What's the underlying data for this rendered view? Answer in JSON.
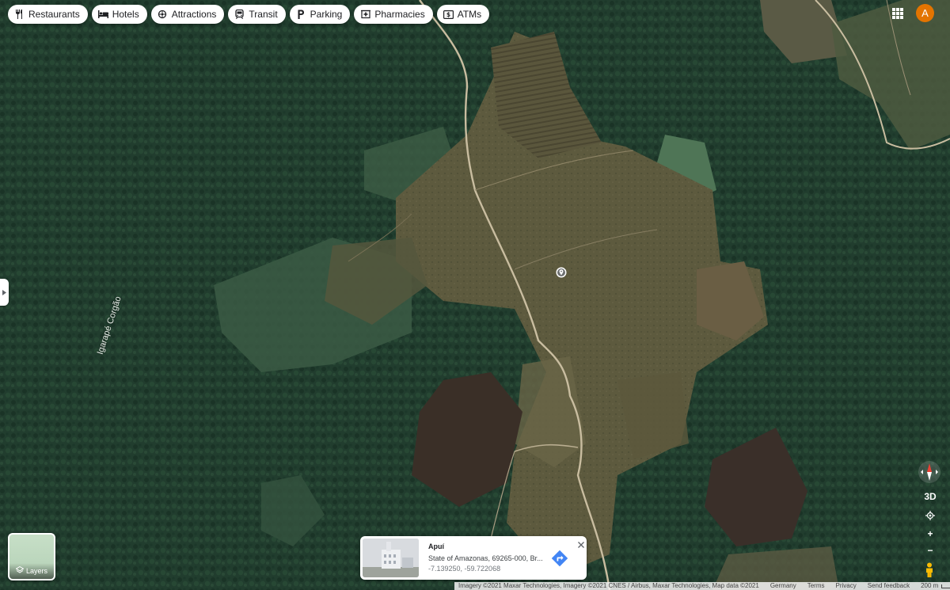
{
  "categories": [
    {
      "label": "Restaurants",
      "icon": "restaurant-icon"
    },
    {
      "label": "Hotels",
      "icon": "hotel-icon"
    },
    {
      "label": "Attractions",
      "icon": "attractions-icon"
    },
    {
      "label": "Transit",
      "icon": "transit-icon"
    },
    {
      "label": "Parking",
      "icon": "parking-icon"
    },
    {
      "label": "Pharmacies",
      "icon": "pharmacy-icon"
    },
    {
      "label": "ATMs",
      "icon": "atm-icon"
    }
  ],
  "account": {
    "initial": "A",
    "color": "#e37400"
  },
  "map": {
    "place_label": "Igarapé Corgão",
    "view": "satellite"
  },
  "layers": {
    "label": "Layers"
  },
  "info_card": {
    "title": "Apuí",
    "address": "State of Amazonas, 69265-000, Br...",
    "coordinates": "-7.139250, -59.722068"
  },
  "controls": {
    "tilt_label": "3D",
    "zoom_in": "+",
    "zoom_out": "−"
  },
  "footer": {
    "attribution": "Imagery ©2021 Maxar Technologies, Imagery ©2021 CNES / Airbus, Maxar Technologies, Map data ©2021",
    "region": "Germany",
    "terms": "Terms",
    "privacy": "Privacy",
    "feedback": "Send feedback",
    "scale": "200 m"
  },
  "colors": {
    "forest": "#1f3a2c",
    "cleared": "#5e5b3f",
    "road": "#c9bda0",
    "accent_blue": "#4285f4"
  }
}
